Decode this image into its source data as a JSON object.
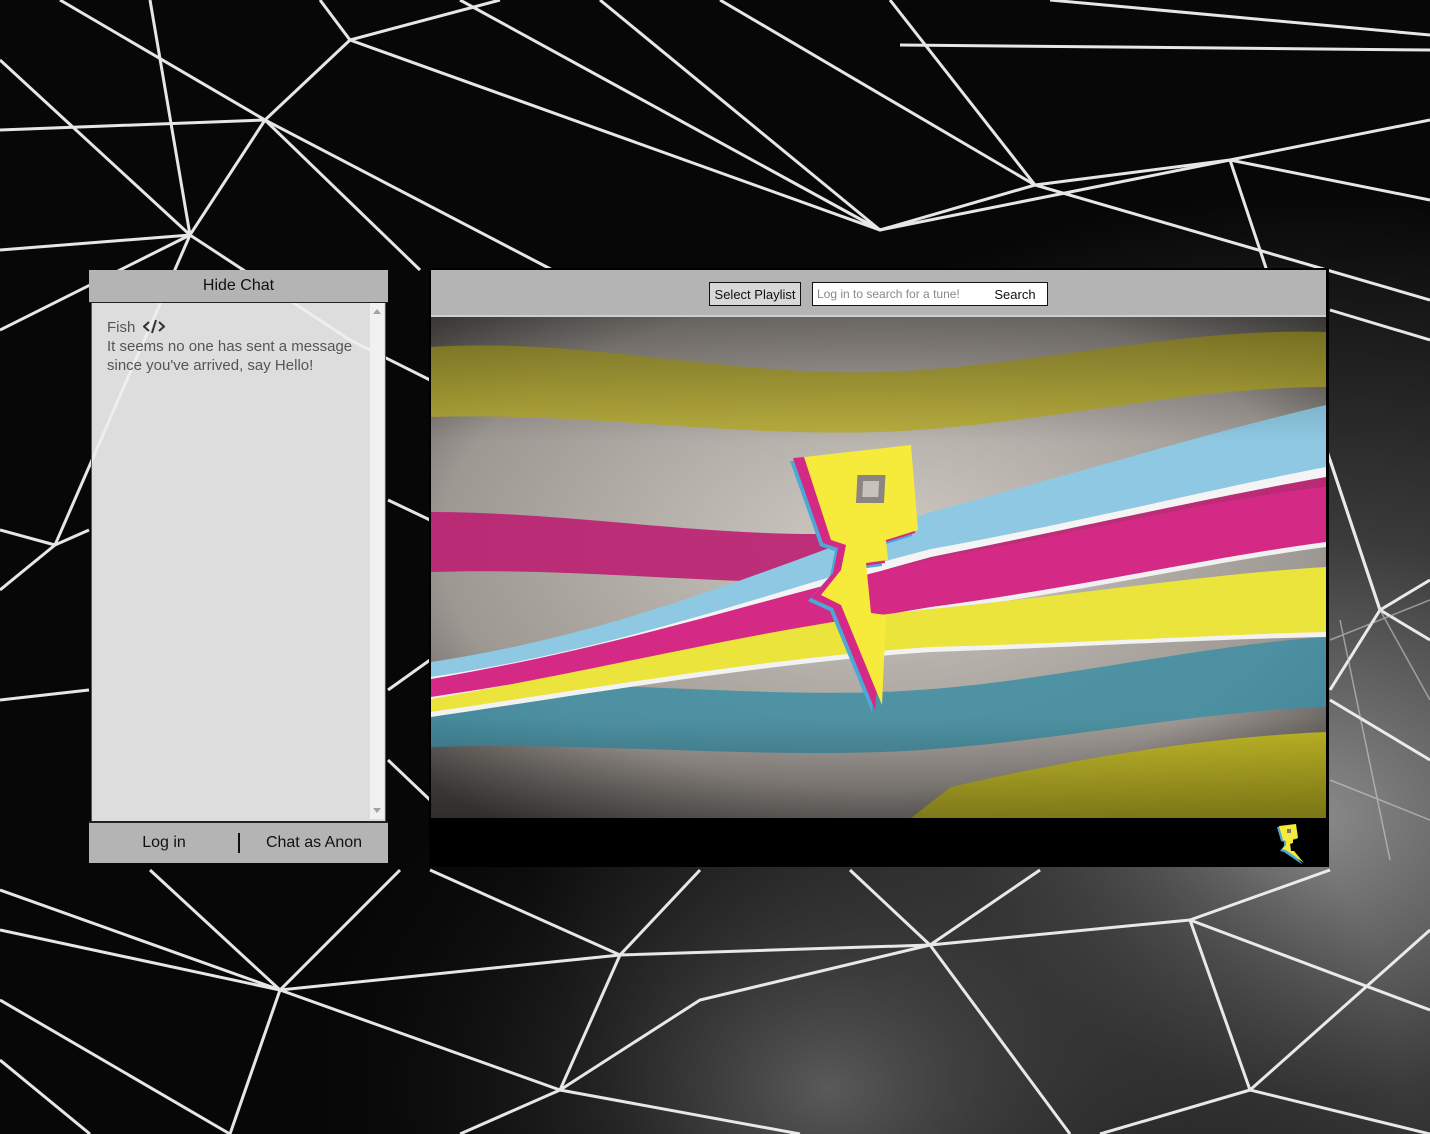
{
  "chat": {
    "toggle_label": "Hide Chat",
    "messages": [
      {
        "user": "Fish",
        "user_icon": "code-icon",
        "text": "It seems no one has sent a message since you've arrived, say Hello!"
      }
    ],
    "login_label": "Log in",
    "anon_label": "Chat as Anon"
  },
  "player": {
    "select_playlist_label": "Select Playlist",
    "search_placeholder": "Log in to search for a tune!",
    "search_value": "",
    "search_button_label": "Search",
    "video_icon": "proximity-logo",
    "watermark_icon": "proximity-logo"
  },
  "colors": {
    "panel_gray": "#b4b4b4",
    "chat_background": "#eeeeee",
    "stripe_yellow": "#e6df3a",
    "stripe_magenta": "#cf2680",
    "stripe_blue": "#8fc6e0",
    "logo_yellow": "#f6ea3a"
  }
}
